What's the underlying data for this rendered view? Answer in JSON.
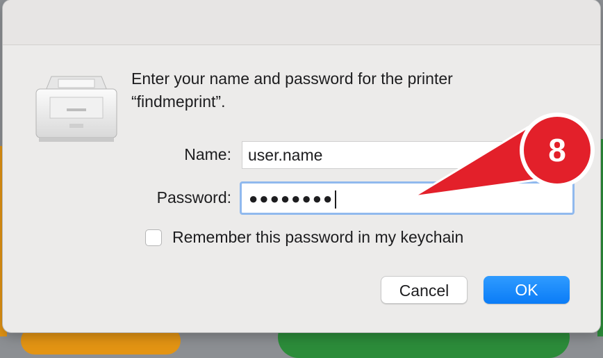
{
  "dialog": {
    "message_line1": "Enter your name and password for the printer",
    "message_line2": "“findmeprint”."
  },
  "form": {
    "name_label": "Name:",
    "name_value": "user.name",
    "password_label": "Password:",
    "password_value": "●●●●●●●●",
    "remember_label": "Remember this password in my keychain",
    "remember_checked": false
  },
  "buttons": {
    "cancel_label": "Cancel",
    "ok_label": "OK"
  },
  "annotation": {
    "step_number": "8",
    "color": "#e3202a"
  },
  "icons": {
    "printer": "printer-icon"
  }
}
